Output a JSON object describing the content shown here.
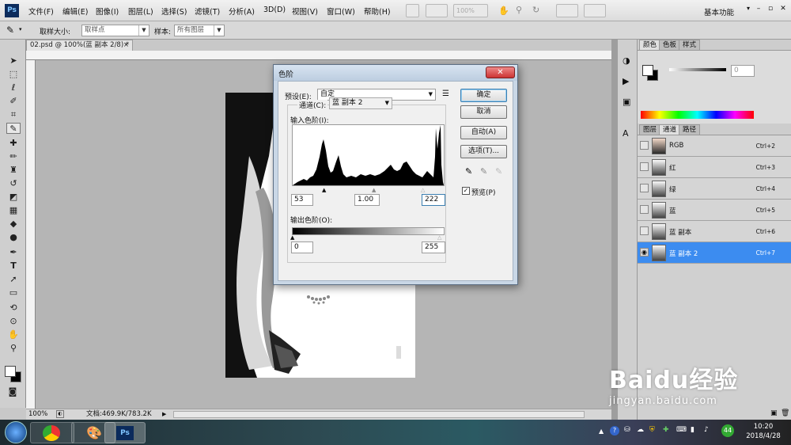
{
  "app": {
    "logo": "Ps",
    "menu": [
      "文件(F)",
      "编辑(E)",
      "图像(I)",
      "图层(L)",
      "选择(S)",
      "滤镜(T)",
      "分析(A)",
      "3D(D)",
      "视图(V)",
      "窗口(W)",
      "帮助(H)"
    ],
    "zoom_combo": "100%",
    "workspace": "基本功能"
  },
  "options": {
    "sample_size_label": "取样大小:",
    "sample_size_value": "取样点",
    "sample_label": "样本:",
    "sample_value": "所有图层"
  },
  "document": {
    "tab": "02.psd @ 100%(蓝 副本 2/8) *",
    "status_zoom": "100%",
    "status_doc": "文档:469.9K/783.2K"
  },
  "panels": {
    "color_tabs": [
      "颜色",
      "色板",
      "样式"
    ],
    "color_value": "0",
    "layer_tabs": [
      "图层",
      "通道",
      "路径"
    ],
    "channels": [
      {
        "name": "RGB",
        "shortcut": "Ctrl+2",
        "selected": false
      },
      {
        "name": "红",
        "shortcut": "Ctrl+3",
        "selected": false
      },
      {
        "name": "绿",
        "shortcut": "Ctrl+4",
        "selected": false
      },
      {
        "name": "蓝",
        "shortcut": "Ctrl+5",
        "selected": false
      },
      {
        "name": "蓝 副本",
        "shortcut": "Ctrl+6",
        "selected": false
      },
      {
        "name": "蓝 副本 2",
        "shortcut": "Ctrl+7",
        "selected": true
      }
    ]
  },
  "dialog": {
    "title": "色阶",
    "preset_label": "预设(E):",
    "preset_value": "自定",
    "channel_label": "通道(C):",
    "channel_value": "蓝 副本 2",
    "input_label": "输入色阶(I):",
    "input_black": "53",
    "input_gamma": "1.00",
    "input_white": "222",
    "output_label": "输出色阶(O):",
    "output_black": "0",
    "output_white": "255",
    "ok": "确定",
    "cancel": "取消",
    "auto": "自动(A)",
    "options": "选项(T)...",
    "preview": "预览(P)",
    "preview_checked": true
  },
  "taskbar": {
    "time": "10:20",
    "date": "2018/4/28",
    "badge": "44"
  },
  "watermark": {
    "brand": "Baidu经验",
    "url": "jingyan.baidu.com"
  },
  "colors": {
    "selection": "#3c8cf0",
    "dialog_frame": "#c9d7e6",
    "ps_blue": "#0b2b5c"
  }
}
